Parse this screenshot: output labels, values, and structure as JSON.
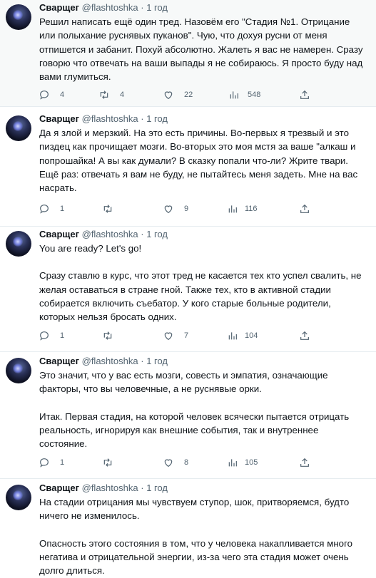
{
  "tweets": [
    {
      "author": "Сварщег",
      "handle": "@flashtoshka",
      "sep": "·",
      "time": "1 год",
      "paragraphs": [
        "Решил написать ещё один тред. Назовём его \"Стадия №1. Отрицание или полыхание руснявых пуканов\". Чую, что дохуя русни от меня отпишется и забанит. Похуй абсолютно. Жалеть я вас не намерен. Сразу говорю что отвечать на ваши выпады я не собираюсь. Я просто буду над вами глумиться."
      ],
      "replies": "4",
      "retweets": "4",
      "likes": "22",
      "views": "548"
    },
    {
      "author": "Сварщег",
      "handle": "@flashtoshka",
      "sep": "·",
      "time": "1 год",
      "paragraphs": [
        "Да я злой и мерзкий. На это есть причины. Во-первых я трезвый и это пиздец как прочищает мозги. Во-вторых это моя мстя за ваше \"алкаш и попрошайка! А вы как думали? В сказку попали что-ли? Жрите твари. Ещё раз: отвечать я вам не буду, не пытайтесь меня задеть. Мне на вас насрать."
      ],
      "replies": "1",
      "retweets": "",
      "likes": "9",
      "views": "116"
    },
    {
      "author": "Сварщег",
      "handle": "@flashtoshka",
      "sep": "·",
      "time": "1 год",
      "paragraphs": [
        "You are ready? Let's go!",
        "Сразу ставлю в курс, что этот тред не касается тех кто успел свалить, не желая оставаться в стране гной. Также тех, кто в активной стадии собирается включить съебатор. У кого старые больные родители, которых нельзя бросать одних."
      ],
      "replies": "1",
      "retweets": "",
      "likes": "7",
      "views": "104"
    },
    {
      "author": "Сварщег",
      "handle": "@flashtoshka",
      "sep": "·",
      "time": "1 год",
      "paragraphs": [
        "Это значит, что у вас есть мозги, совесть и эмпатия, означающие факторы, что вы человечные, а не руснявые орки.",
        "Итак. Первая стадия, на которой человек всячески пытается отрицать реальность, игнорируя как внешние события, так и внутреннее состояние."
      ],
      "replies": "1",
      "retweets": "",
      "likes": "8",
      "views": "105"
    },
    {
      "author": "Сварщег",
      "handle": "@flashtoshka",
      "sep": "·",
      "time": "1 год",
      "paragraphs": [
        "На стадии отрицания мы чувствуем ступор, шок, притворяемся, будто ничего не изменилось.",
        "Опасность этого состояния в том, что у человека накапливается много негатива и отрицательной энергии, из-за чего эта стадия может очень долго длиться."
      ]
    }
  ],
  "icons": {
    "reply": "reply-icon",
    "retweet": "retweet-icon",
    "like": "like-icon",
    "views": "views-icon",
    "share": "share-icon"
  },
  "colors": {
    "text": "#0f1419",
    "muted": "#536471",
    "highlight_bg": "#f7f9f9",
    "divider": "#e6ecf0"
  }
}
